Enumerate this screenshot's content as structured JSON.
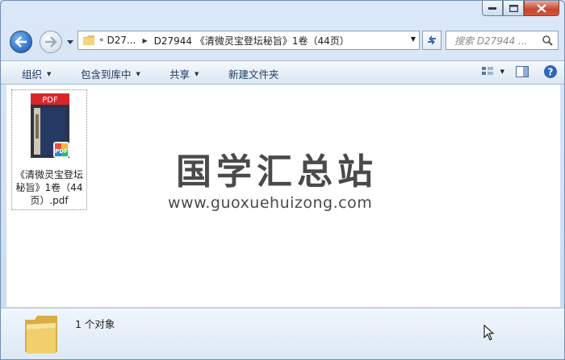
{
  "window": {
    "minimize_label": "minimize",
    "maximize_label": "maximize",
    "close_label": "close"
  },
  "address": {
    "chevron": "«",
    "segments": [
      "D27...",
      "D27944 《清微灵宝登坛秘旨》1卷（44页）"
    ]
  },
  "search": {
    "placeholder": "搜索 D27944 ..."
  },
  "toolbar": {
    "organize": "组织",
    "include_in_library": "包含到库中",
    "share": "共享",
    "new_folder": "新建文件夹"
  },
  "file": {
    "name_line1": "《清微灵宝登坛",
    "name_line2": "秘旨》1卷（44",
    "name_line3": "页）.pdf",
    "thumb_label": "PDF"
  },
  "watermark": {
    "title": "国学汇总站",
    "url": "www.guoxuehuizong.com"
  },
  "status": {
    "count_text": "1 个对象"
  },
  "colors": {
    "accent": "#2a6cc4",
    "pdf_red": "#d8262b",
    "close_red": "#c7462f"
  }
}
